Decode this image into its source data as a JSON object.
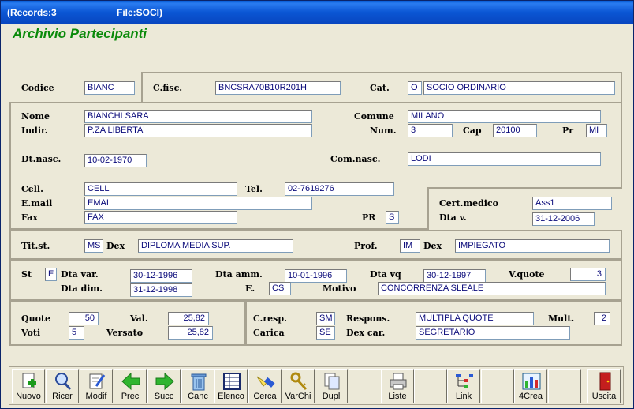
{
  "window": {
    "records": "(Records:3",
    "file": "File:SOCI)"
  },
  "app_title": "Archivio Partecipanti",
  "labels": {
    "codice": "Codice",
    "cfisc": "C.fisc.",
    "cat": "Cat.",
    "nome": "Nome",
    "indir": "Indir.",
    "comune": "Comune",
    "num": "Num.",
    "cap": "Cap",
    "pr": "Pr",
    "dtnasc": "Dt.nasc.",
    "comnasc": "Com.nasc.",
    "cell": "Cell.",
    "tel": "Tel.",
    "email": "E.mail",
    "fax": "Fax",
    "pr2": "PR",
    "certmedico": "Cert.medico",
    "dtav": "Dta v.",
    "titst": "Tit.st.",
    "dex1": "Dex",
    "prof": "Prof.",
    "dex2": "Dex",
    "st": "St",
    "dtavar": "Dta var.",
    "dtaamm": "Dta amm.",
    "dtavq": "Dta vq",
    "vquote": "V.quote",
    "dtadim": "Dta dim.",
    "e": "E.",
    "motivo": "Motivo",
    "quote": "Quote",
    "val": "Val.",
    "voti": "Voti",
    "versato": "Versato",
    "cresp": "C.resp.",
    "respons": "Respons.",
    "mult": "Mult.",
    "carica": "Carica",
    "dexcar": "Dex car."
  },
  "fields": {
    "codice": "BIANC",
    "cfisc": "BNCSRA70B10R201H",
    "cat_code": "O",
    "cat_desc": "SOCIO ORDINARIO",
    "nome": "BIANCHI SARA",
    "comune": "MILANO",
    "indir": "P.ZA LIBERTA'",
    "num": "3",
    "cap": "20100",
    "pr": "MI",
    "dtnasc": "10-02-1970",
    "comnasc": "LODI",
    "cell": "CELL",
    "tel": "02-7619276",
    "email": "EMAI",
    "fax": "FAX",
    "pr2": "S",
    "certmedico": "Ass1",
    "dtav": "31-12-2006",
    "titst": "MS",
    "titst_dex": "DIPLOMA MEDIA SUP.",
    "prof": "IM",
    "prof_dex": "IMPIEGATO",
    "st": "E",
    "dtavar": "30-12-1996",
    "dtaamm": "10-01-1996",
    "dtavq": "30-12-1997",
    "vquote": "3",
    "dtadim": "31-12-1998",
    "e": "CS",
    "motivo": "CONCORRENZA SLEALE",
    "quote": "50",
    "val": "25,82",
    "voti": "5",
    "versato": "25,82",
    "cresp": "SM",
    "respons": "MULTIPLA QUOTE",
    "mult": "2",
    "carica": "SE",
    "dexcar": "SEGRETARIO"
  },
  "toolbar": {
    "nuovo": "Nuovo",
    "ricer": "Ricer",
    "modif": "Modif",
    "prec": "Prec",
    "succ": "Succ",
    "canc": "Canc",
    "elenco": "Elenco",
    "cerca": "Cerca",
    "varchi": "VarChi",
    "dupl": "Dupl",
    "liste": "Liste",
    "link": "Link",
    "crea": "4Crea",
    "uscita": "Uscita"
  }
}
